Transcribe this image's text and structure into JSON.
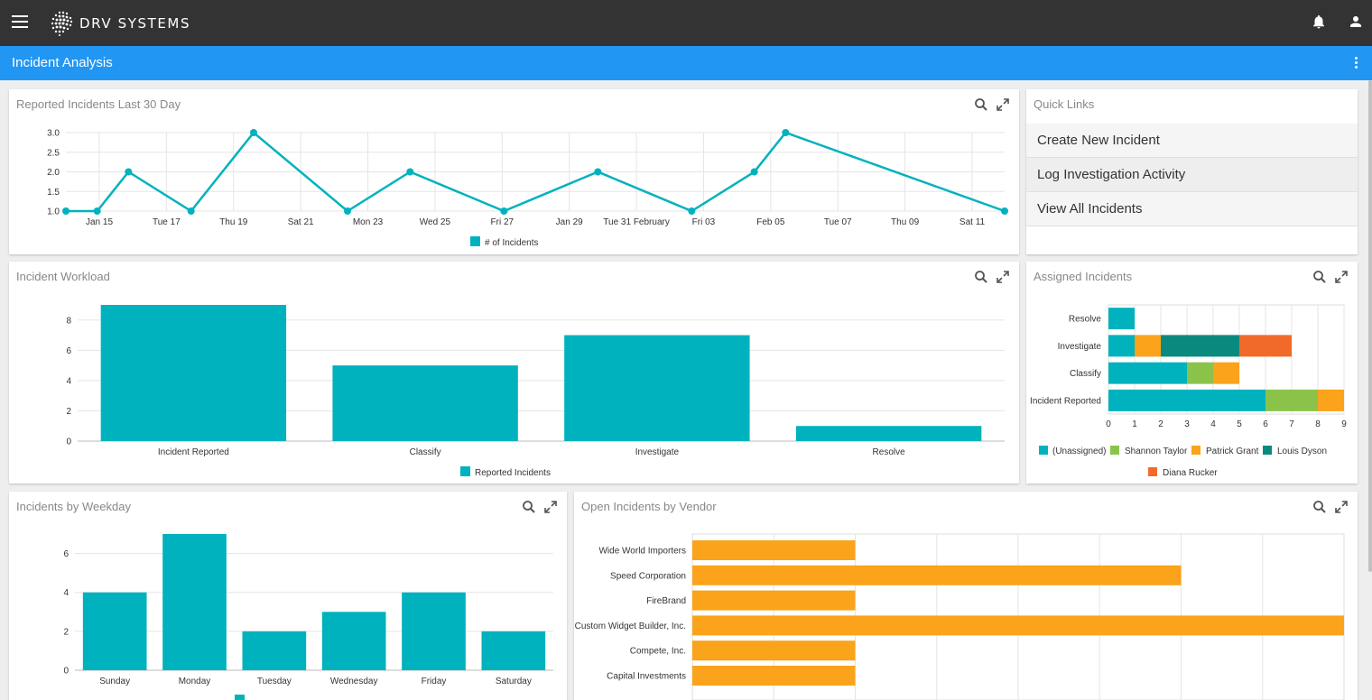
{
  "app": {
    "brand": "DRV SYSTEMS",
    "page_title": "Incident Analysis"
  },
  "panels": {
    "reported": {
      "title": "Reported Incidents Last 30 Day"
    },
    "quick_links": {
      "title": "Quick Links",
      "items": [
        "Create New Incident",
        "Log Investigation Activity",
        "View All Incidents"
      ]
    },
    "workload": {
      "title": "Incident Workload"
    },
    "assigned": {
      "title": "Assigned Incidents"
    },
    "weekday": {
      "title": "Incidents by Weekday"
    },
    "vendor": {
      "title": "Open Incidents by Vendor"
    }
  },
  "icons": {
    "menu": "menu-icon",
    "bell": "bell-icon",
    "user": "user-icon",
    "more": "more-vert-icon",
    "search": "search-icon",
    "expand": "expand-icon"
  },
  "colors": {
    "topbar": "#333333",
    "accent": "#2196f3",
    "teal": "#00b2bd",
    "green": "#8bc34a",
    "orange": "#faa31b",
    "darkteal": "#0a8a7f",
    "red": "#f26a2a"
  },
  "chart_data": [
    {
      "id": "reported",
      "type": "line",
      "x_tick_labels": [
        "Jan 15",
        "Tue 17",
        "Thu 19",
        "Sat 21",
        "Mon 23",
        "Wed 25",
        "Fri 27",
        "Jan 29",
        "Tue 31 February",
        "Fri 03",
        "Feb 05",
        "Tue 07",
        "Thu 09",
        "Sat 11"
      ],
      "x_dates": [
        "Jan 14",
        "Jan 15",
        "Jan 16",
        "Jan 18",
        "Jan 20",
        "Jan 23",
        "Jan 25",
        "Jan 28",
        "Jan 31",
        "Feb 03",
        "Feb 05",
        "Feb 06",
        "Feb 13"
      ],
      "series": [
        {
          "name": "# of Incidents",
          "values": [
            1,
            1,
            2,
            1,
            3,
            1,
            2,
            1,
            2,
            1,
            2,
            3,
            1
          ]
        }
      ],
      "yticks": [
        "1.0",
        "1.5",
        "2.0",
        "2.5",
        "3.0"
      ],
      "ylim": [
        1,
        3
      ],
      "legend": "bottom"
    },
    {
      "id": "workload",
      "type": "bar",
      "categories": [
        "Incident Reported",
        "Classify",
        "Investigate",
        "Resolve"
      ],
      "series": [
        {
          "name": "Reported Incidents",
          "values": [
            9,
            5,
            7,
            1
          ]
        }
      ],
      "yticks": [
        "0",
        "2",
        "4",
        "6",
        "8"
      ],
      "ylim": [
        0,
        9
      ],
      "legend": "bottom"
    },
    {
      "id": "assigned",
      "type": "bar",
      "orientation": "horizontal",
      "stacked": true,
      "categories": [
        "Resolve",
        "Investigate",
        "Classify",
        "Incident Reported"
      ],
      "series": [
        {
          "name": "(Unassigned)",
          "values": [
            1,
            1,
            3,
            6
          ]
        },
        {
          "name": "Shannon Taylor",
          "values": [
            0,
            0,
            1,
            2
          ]
        },
        {
          "name": "Patrick Grant",
          "values": [
            0,
            1,
            1,
            1
          ]
        },
        {
          "name": "Louis Dyson",
          "values": [
            0,
            3,
            0,
            0
          ]
        },
        {
          "name": "Diana Rucker",
          "values": [
            0,
            2,
            0,
            0
          ]
        }
      ],
      "xticks": [
        "0",
        "1",
        "2",
        "3",
        "4",
        "5",
        "6",
        "7",
        "8",
        "9"
      ],
      "xlim": [
        0,
        9
      ],
      "legend": "bottom"
    },
    {
      "id": "weekday",
      "type": "bar",
      "categories": [
        "Sunday",
        "Monday",
        "Tuesday",
        "Wednesday",
        "Friday",
        "Saturday"
      ],
      "series": [
        {
          "values": [
            4,
            7,
            2,
            3,
            4,
            2
          ]
        }
      ],
      "yticks": [
        "0",
        "2",
        "4",
        "6"
      ],
      "ylim": [
        0,
        7
      ],
      "legend": "bottom"
    },
    {
      "id": "vendor",
      "type": "bar",
      "orientation": "horizontal",
      "categories": [
        "Wide World Importers",
        "Speed Corporation",
        "FireBrand",
        "Custom Widget Builder, Inc.",
        "Compete, Inc.",
        "Capital Investments"
      ],
      "series": [
        {
          "values": [
            2,
            6,
            2,
            8,
            2,
            2
          ]
        }
      ],
      "xlim": [
        0,
        8
      ]
    }
  ]
}
